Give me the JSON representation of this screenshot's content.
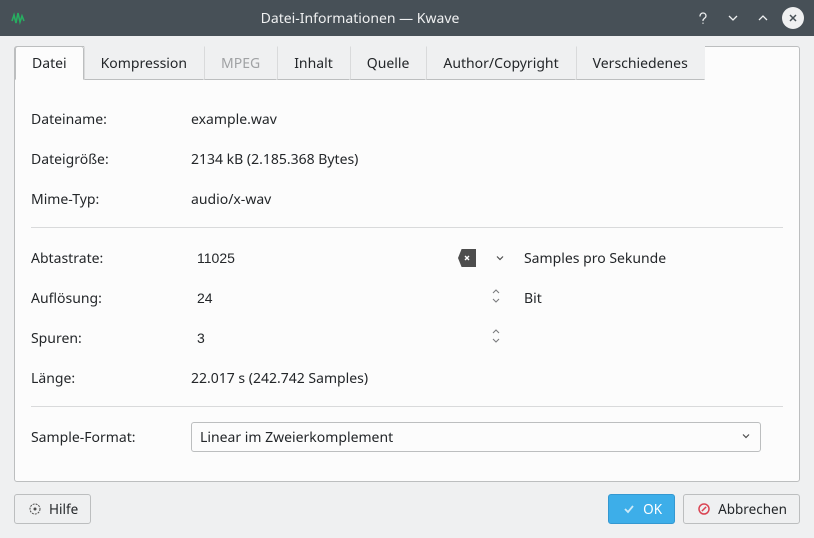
{
  "window": {
    "title": "Datei-Informationen — Kwave"
  },
  "tabs": {
    "file": "Datei",
    "compression": "Kompression",
    "mpeg": "MPEG",
    "content": "Inhalt",
    "source": "Quelle",
    "author": "Author/Copyright",
    "misc": "Verschiedenes"
  },
  "labels": {
    "filename": "Dateiname:",
    "filesize": "Dateigröße:",
    "mimetype": "Mime-Typ:",
    "samplerate": "Abtastrate:",
    "resolution": "Auflösung:",
    "tracks": "Spuren:",
    "length": "Länge:",
    "sampleformat": "Sample-Format:"
  },
  "values": {
    "filename": "example.wav",
    "filesize": "2134 kB (2.185.368 Bytes)",
    "mimetype": "audio/x-wav",
    "samplerate": "11025",
    "samplerate_unit": "Samples pro Sekunde",
    "resolution": "24",
    "resolution_unit": "Bit",
    "tracks": "3",
    "length": "22.017 s (242.742 Samples)",
    "sampleformat": "Linear im Zweierkomplement"
  },
  "buttons": {
    "help": "Hilfe",
    "ok": "OK",
    "cancel": "Abbrechen"
  }
}
